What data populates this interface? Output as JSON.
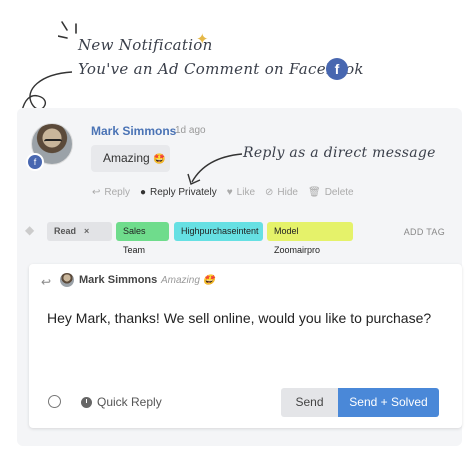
{
  "annotations": {
    "line1": "New Notification",
    "line2": "You've an Ad Comment on Facebook",
    "line3": "Reply as a direct message",
    "facebook_icon": "facebook-icon"
  },
  "comment": {
    "author": "Mark Simmons",
    "time": "1d ago",
    "text": "Amazing",
    "emoji": "🤩"
  },
  "actions": [
    {
      "label": "Reply",
      "icon": "reply-icon"
    },
    {
      "label": "Reply Privately",
      "icon": "messenger-icon"
    },
    {
      "label": "Like",
      "icon": "heart-icon"
    },
    {
      "label": "Hide",
      "icon": "eye-slash-icon"
    },
    {
      "label": "Delete",
      "icon": "trash-icon"
    }
  ],
  "tags": {
    "items": [
      {
        "label": "Read",
        "color": "#e2e3e6"
      },
      {
        "label": "Sales Team",
        "color": "#6fdc8c"
      },
      {
        "label": "Highpurchaseintent",
        "color": "#66e0e3"
      },
      {
        "label": "Model Zoomairpro",
        "color": "#e5f26a"
      }
    ],
    "remove_glyph": "×",
    "add_label": "ADD TAG"
  },
  "composer": {
    "reply_to": "Mark Simmons",
    "quoted": "Amazing",
    "quoted_emoji": "🤩",
    "message": "Hey Mark, thanks! We sell online, would you like to purchase?",
    "quick_reply_label": "Quick Reply",
    "send_label": "Send",
    "send_solved_label": "Send + Solved"
  },
  "colors": {
    "link_blue": "#4a73b5",
    "primary_button": "#4a88d8",
    "facebook_blue": "#4867b0"
  }
}
